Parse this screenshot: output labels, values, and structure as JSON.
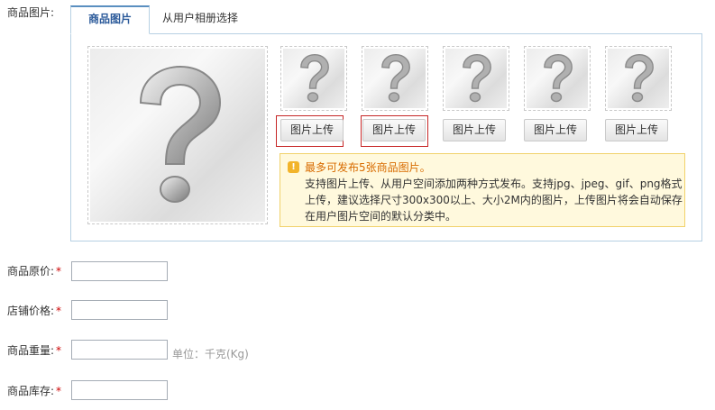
{
  "image_section": {
    "label": "商品图片:",
    "tabs": [
      {
        "label": "商品图片",
        "active": true
      },
      {
        "label": "从用户相册选择",
        "active": false
      }
    ],
    "upload_button_label": "图片上传",
    "thumbnail_count": 5,
    "notice": {
      "title": "最多可发布5张商品图片。",
      "lines": [
        "支持图片上传、从用户空间添加两种方式发布。支持jpg、jpeg、gif、png格式",
        "上传，建议选择尺寸300x300以上、大小2M内的图片，上传图片将会自动保存",
        "在用户图片空间的默认分类中。"
      ]
    }
  },
  "fields": [
    {
      "label": "商品原价:",
      "required_mark": "*",
      "value": ""
    },
    {
      "label": "店铺价格:",
      "required_mark": "*",
      "value": ""
    },
    {
      "label": "商品重量:",
      "required_mark": "*",
      "value": "",
      "unit_hint": "单位：千克(Kg)"
    },
    {
      "label": "商品库存:",
      "required_mark": "*",
      "value": ""
    }
  ],
  "colors": {
    "tab_active_text": "#2b5a9a",
    "required_mark": "#cc0000",
    "notice_title": "#d86b00",
    "notice_background": "#fff9dd",
    "upload_highlight": "#c62626"
  },
  "icons": [
    "question-mark-placeholder-icon",
    "warning-icon"
  ]
}
